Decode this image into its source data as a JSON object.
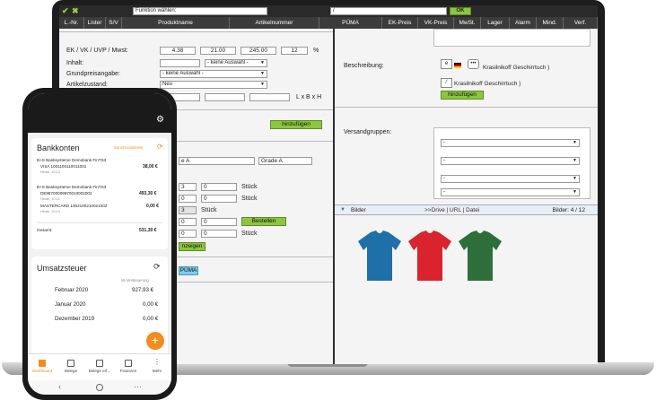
{
  "desktop": {
    "function_select": "Funktion wählen:",
    "slash_select": "/",
    "ok_label": "OK",
    "columns": [
      "L.-Nr.",
      "Lister",
      "S/V",
      "Produktname",
      "Artikelnummer",
      "PÜMA",
      "EK-Preis",
      "VK-Preis",
      "MwSt.",
      "Lager",
      "Alarm",
      "Mind.",
      "Verf."
    ],
    "left": {
      "price_label": "EK / VK / UVP / Mwst:",
      "ek": "4.38",
      "vk": "21.00",
      "uvp": "245.00",
      "mwst": "12",
      "percent": "%",
      "inhalt_label": "Inhalt:",
      "inhalt_select": "- keine Auswahl -",
      "grundpreis_label": "Grundpreisangabe:",
      "grundpreis_select": "- keine Auswahl -",
      "zustand_label": "Artikelzustand:",
      "zustand_select": "Neu",
      "dims_label": "L x B x H",
      "hinzufuegen": "hinzufügen",
      "grade_a_1": "e A",
      "grade_a_2": "Grade A",
      "stock_rows": [
        {
          "a": "3",
          "b": "0",
          "unit": "Stück"
        },
        {
          "a": "0",
          "b": "0",
          "unit": "Stück"
        },
        {
          "a": "3",
          "b": "",
          "unit": "Stück"
        },
        {
          "a": "0",
          "b": "0",
          "unit": ""
        },
        {
          "a": "0",
          "b": "0",
          "unit": "Stück"
        }
      ],
      "bestellen": "Bestellen",
      "anzeigen": "nzeigen",
      "puma_btn": "PÜMA"
    },
    "right": {
      "beschreibung_label": "Beschreibung:",
      "image_alt_1": "Krasilnikoff Geschirrtuch )",
      "image_alt_2": "Krasilnikoff Geschirrtuch )",
      "hinzufuegen": "hinzufügen",
      "versandgruppen_label": "Versandgruppen:",
      "versand_selects": [
        "-",
        "-",
        "-",
        "-"
      ],
      "bilder_label": "Bilder",
      "bilder_links": ">>Drive | URL | Datei",
      "bilder_count": "Bilder: 4 / 12",
      "shirt_colors": [
        "#1f6fa8",
        "#d9232d",
        "#2e6e3a"
      ]
    }
  },
  "phone": {
    "bank_title": "Bankkonten",
    "sync_label": "Synchronisieren",
    "bank1_name": "B+S Banksysteme Demobank FinTS3",
    "bank1_acc": "VISA 1001100110011001",
    "bank1_amount": "38,00 €",
    "bank1_time": "Heute, 10:13",
    "bank2_name": "B+S Banksysteme Demobank FinTS3",
    "bank2_acc": "DE98700009970010002002",
    "bank2_amount": "493,30 €",
    "bank2_time": "Heute, 10:13",
    "bank3_acc": "MASTERCARD 1002100210021002",
    "bank3_amount": "0,00 €",
    "bank3_time": "Heute, 10:13",
    "total_label": "Gesamt:",
    "total_amount": "531,30 €",
    "ust_title": "Umsatzsteuer",
    "ust_sub": "Ist-Versteuerung",
    "ust_rows": [
      {
        "month": "Februar 2020",
        "value": "927,93 €"
      },
      {
        "month": "Januar 2020",
        "value": "0,00 €"
      },
      {
        "month": "Dezember 2019",
        "value": "0,00 €"
      }
    ],
    "tabs": [
      "Dashboard",
      "Belege",
      "Belege erf...",
      "Finanzen",
      "Mehr"
    ],
    "fab": "+",
    "accent": "#f28c1e"
  }
}
